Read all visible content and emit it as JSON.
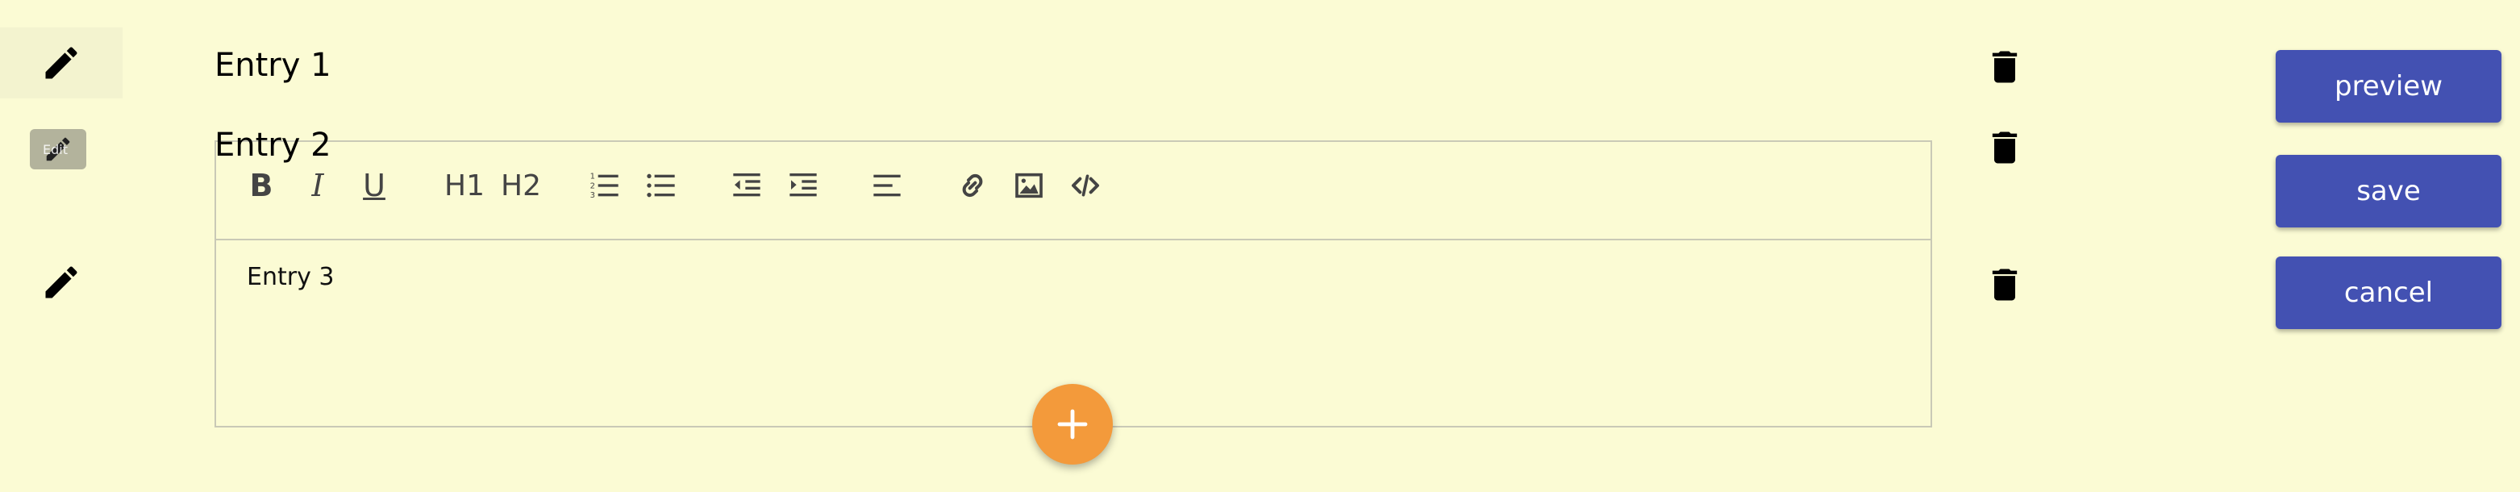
{
  "entries": [
    {
      "title": "Entry 1"
    },
    {
      "title": "Entry 2"
    },
    {
      "title": "Entry 3"
    }
  ],
  "edit_tooltip": "Edit",
  "editor": {
    "content": "Entry 3",
    "toolbar": {
      "bold": "B",
      "italic": "I",
      "underline": "U",
      "h1": "H1",
      "h2": "H2"
    }
  },
  "actions": {
    "preview": "preview",
    "save": "save",
    "cancel": "cancel"
  },
  "colors": {
    "background": "#fbfbd4",
    "primary_button": "#4351b2",
    "fab": "#f39a3b"
  },
  "icons": [
    "pencil-icon",
    "trash-icon",
    "plus-icon",
    "ordered-list-icon",
    "bullet-list-icon",
    "outdent-icon",
    "indent-icon",
    "align-left-icon",
    "link-icon",
    "image-icon",
    "code-icon"
  ]
}
